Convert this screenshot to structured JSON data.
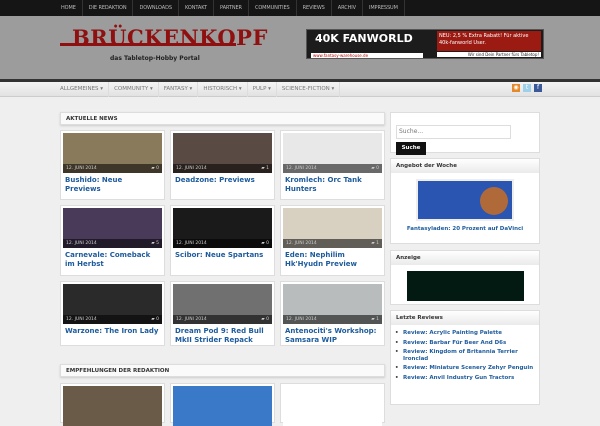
{
  "topnav": [
    "HOME",
    "DIE REDAKTION",
    "DOWNLOADS",
    "KONTAKT",
    "PARTNER",
    "COMMUNITIES",
    "REVIEWS",
    "ARCHIV",
    "IMPRESSUM"
  ],
  "logo": {
    "title": "BRÜCKENKOPF",
    "subtitle": "das Tabletop-Hobby Portal"
  },
  "banner": {
    "title": "40K FANWORLD",
    "url": "www.fantasy-warehouse.de",
    "promo": "NEU: 2,5 % Extra Rabatt! Für aktive 40k-fanworld User.",
    "tagline": "Wir sind Dein Partner fürs Tabletop!"
  },
  "menu": [
    "ALLGEMEINES ▾",
    "COMMUNITY ▾",
    "FANTASY ▾",
    "HISTORISCH ▾",
    "PULP ▾",
    "SCIENCE-FICTION ▾"
  ],
  "social": [
    "rss-icon",
    "twitter-icon",
    "facebook-icon"
  ],
  "news": {
    "heading": "AKTUELLE NEWS",
    "items": [
      {
        "date": "12. JUNI 2014",
        "comments": "0",
        "title": "Bushido: Neue Previews",
        "color": "#8a7a5c"
      },
      {
        "date": "12. JUNI 2014",
        "comments": "1",
        "title": "Deadzone: Previews",
        "color": "#5a4a44"
      },
      {
        "date": "12. JUNI 2014",
        "comments": "0",
        "title": "Kromlech: Orc Tank Hunters",
        "color": "#e8e8e8"
      },
      {
        "date": "12. JUNI 2014",
        "comments": "5",
        "title": "Carnevale: Comeback im Herbst",
        "color": "#4a3a5a"
      },
      {
        "date": "12. JUNI 2014",
        "comments": "0",
        "title": "Scibor: Neue Spartans",
        "color": "#1a1a1a"
      },
      {
        "date": "12. JUNI 2014",
        "comments": "1",
        "title": "Eden: Nephilim Hk'Hyudn Preview",
        "color": "#d8d0c0"
      },
      {
        "date": "12. JUNI 2014",
        "comments": "0",
        "title": "Warzone: The Iron Lady",
        "color": "#2a2a2a"
      },
      {
        "date": "12. JUNI 2014",
        "comments": "0",
        "title": "Dream Pod 9: Red Bull MkII Strider Repack",
        "color": "#707070"
      },
      {
        "date": "12. JUNI 2014",
        "comments": "1",
        "title": "Antenociti's Workshop: Samsara WIP",
        "color": "#b8bcbc"
      }
    ]
  },
  "recommend": {
    "heading": "EMPFEHLUNGEN DER REDAKTION",
    "colors": [
      "#6a5a48",
      "#3a78c8",
      "#ffffff"
    ]
  },
  "sidebar": {
    "search": {
      "placeholder": "Suche...",
      "button": "Suche"
    },
    "offer": {
      "heading": "Angebot der Woche",
      "link": "Fantasyladen: 20 Prozent auf DaVinci"
    },
    "ad": {
      "heading": "Anzeige"
    },
    "reviews": {
      "heading": "Letzte Reviews",
      "items": [
        "Review: Acrylic Painting Palette",
        "Review: Barbar Für Beer And D6s",
        "Review: Kingdom of Britannia Terrier Ironclad",
        "Review: Miniature Scenery Zehyr Penguin",
        "Review: Anvil Industry Gun Tractors"
      ]
    }
  }
}
